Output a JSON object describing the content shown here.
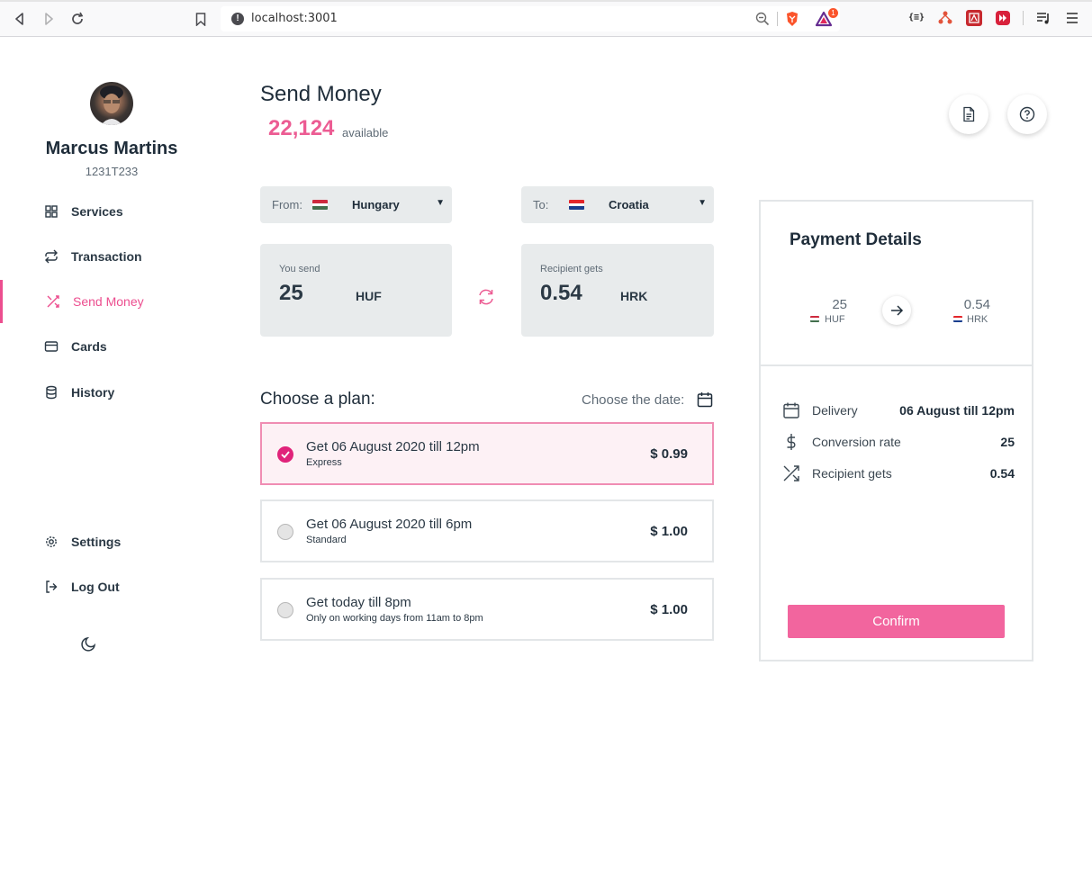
{
  "browser": {
    "url": "localhost:3001",
    "brave_badge": "1"
  },
  "user": {
    "name": "Marcus Martins",
    "id": "1231T233"
  },
  "sidebar": {
    "items": [
      {
        "label": "Services",
        "icon": "grid-icon"
      },
      {
        "label": "Transaction",
        "icon": "repeat-icon"
      },
      {
        "label": "Send Money",
        "icon": "shuffle-icon",
        "active": true
      },
      {
        "label": "Cards",
        "icon": "credit-card-icon"
      },
      {
        "label": "History",
        "icon": "database-icon"
      }
    ],
    "bottom_items": [
      {
        "label": "Settings",
        "icon": "gear-icon"
      },
      {
        "label": "Log Out",
        "icon": "log-out-icon"
      }
    ]
  },
  "main": {
    "title": "Send Money",
    "balance": "22,124",
    "balance_label": "available",
    "from": {
      "label": "From:",
      "country": "Hungary"
    },
    "to": {
      "label": "To:",
      "country": "Croatia"
    },
    "send": {
      "label": "You send",
      "amount": "25",
      "currency": "HUF"
    },
    "receive": {
      "label": "Recipient gets",
      "amount": "0.54",
      "currency": "HRK"
    },
    "plan_heading": "Choose a plan:",
    "date_label": "Choose the date:",
    "plans": [
      {
        "title": "Get 06 August 2020 till 12pm",
        "subtitle": "Express",
        "price": "$ 0.99",
        "selected": true
      },
      {
        "title": "Get 06 August 2020 till 6pm",
        "subtitle": "Standard",
        "price": "$ 1.00",
        "selected": false
      },
      {
        "title": "Get today till 8pm",
        "subtitle": "Only on working days from 11am to 8pm",
        "price": "$ 1.00",
        "selected": false
      }
    ]
  },
  "payment": {
    "title": "Payment Details",
    "from_amount": "25",
    "from_currency": "HUF",
    "to_amount": "0.54",
    "to_currency": "HRK",
    "rows": [
      {
        "label": "Delivery",
        "value": "06 August till 12pm"
      },
      {
        "label": "Conversion rate",
        "value": "25"
      },
      {
        "label": "Recipient gets",
        "value": "0.54"
      }
    ],
    "confirm_label": "Confirm"
  },
  "colors": {
    "accent": "#ec4e8f",
    "confirm": "#f2659e",
    "selected_plan_bg": "#fdf1f5",
    "input_bg": "#e8ebec"
  }
}
